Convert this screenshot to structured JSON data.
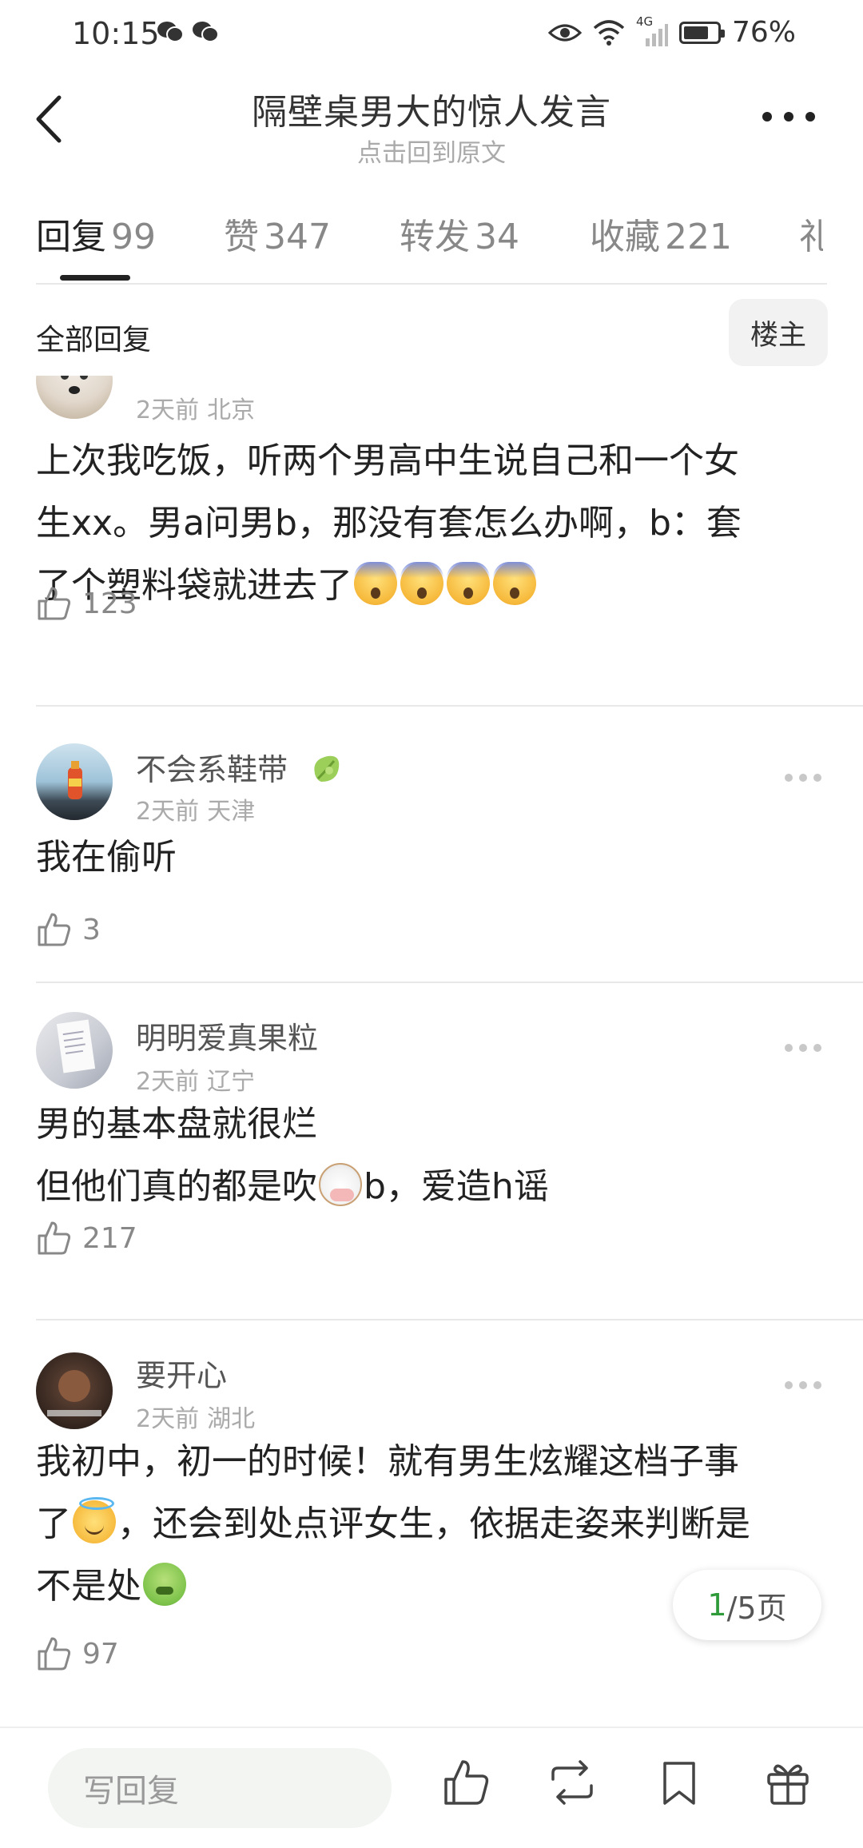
{
  "status_bar": {
    "time": "10:15",
    "network": "4G",
    "battery": "76%",
    "battery_level": 0.76
  },
  "header": {
    "title": "隔壁桌男大的惊人发言",
    "subtitle": "点击回到原文"
  },
  "tabs": [
    {
      "label": "回复",
      "count": "99",
      "active": true
    },
    {
      "label": "赞",
      "count": "347"
    },
    {
      "label": "转发",
      "count": "34"
    },
    {
      "label": "收藏",
      "count": "221"
    },
    {
      "label": "礼",
      "count": ""
    }
  ],
  "filter": {
    "label": "全部回复",
    "owner_button": "楼主"
  },
  "comments": [
    {
      "username": "",
      "time": "2天前",
      "location": "北京",
      "lines": [
        "上次我吃饭，听两个男高中生说自己和一个女",
        "生xx。男a问男b，那没有套怎么办啊，b：套",
        "了个塑料袋就进去了"
      ],
      "emoji_trailing": [
        "fearful-face",
        "fearful-face",
        "fearful-face",
        "fearful-face"
      ],
      "likes": "123"
    },
    {
      "username": "不会系鞋带",
      "badge": "green-leaf-badge",
      "time": "2天前",
      "location": "天津",
      "lines": [
        "我在偷听"
      ],
      "likes": "3"
    },
    {
      "username": "明明爱真果粒",
      "time": "2天前",
      "location": "辽宁",
      "line1": "男的基本盘就很烂",
      "line2_a": "但他们真的都是吹",
      "line2_b": "b，爱造h谣",
      "emoji_inline": "cow-face",
      "likes": "217"
    },
    {
      "username": "要开心",
      "time": "2天前",
      "location": "湖北",
      "line1": "我初中，初一的时候！就有男生炫耀这档子事",
      "line2_a": "了",
      "line2_b": "，还会到处点评女生，依据走姿来判断是",
      "line3": "不是处",
      "emoji_1": "smiling-face-with-halo",
      "emoji_2": "nauseated-face",
      "likes": "97"
    }
  ],
  "page_indicator": {
    "current": "1",
    "total": "/5页"
  },
  "bottom_bar": {
    "reply_placeholder": "写回复"
  }
}
